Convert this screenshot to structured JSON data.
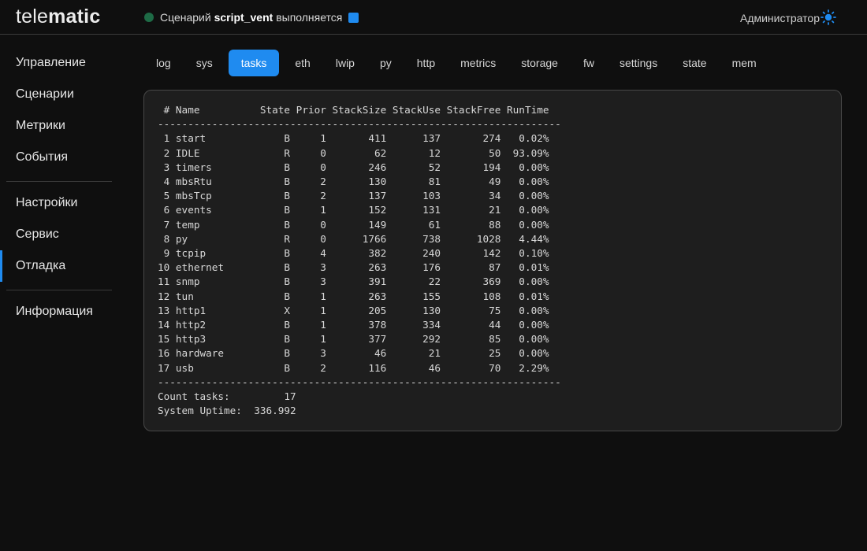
{
  "header": {
    "logo_light": "tele",
    "logo_bold": "matic",
    "status_prefix": "Сценарий",
    "status_script": "script_vent",
    "status_suffix": "выполняется",
    "user": "Администратор",
    "theme_icon": "sun-icon",
    "colors": {
      "accent": "#1f8bf0",
      "running_dot": "#1e6b46"
    }
  },
  "sidebar": {
    "items": [
      {
        "label": "Управление"
      },
      {
        "label": "Сценарии"
      },
      {
        "label": "Метрики"
      },
      {
        "label": "События"
      },
      {
        "label": "Настройки"
      },
      {
        "label": "Сервис"
      },
      {
        "label": "Отладка",
        "active": true
      },
      {
        "label": "Информация"
      }
    ]
  },
  "tabs": [
    {
      "label": "log"
    },
    {
      "label": "sys"
    },
    {
      "label": "tasks",
      "active": true
    },
    {
      "label": "eth"
    },
    {
      "label": "lwip"
    },
    {
      "label": "py"
    },
    {
      "label": "http"
    },
    {
      "label": "metrics"
    },
    {
      "label": "storage"
    },
    {
      "label": "fw"
    },
    {
      "label": "settings"
    },
    {
      "label": "state"
    },
    {
      "label": "mem"
    }
  ],
  "console": {
    "header": " # Name          State Prior StackSize StackUse StackFree RunTime",
    "separator": "-------------------------------------------------------------------",
    "rows": [
      " 1 start             B     1       411      137       274   0.02%",
      " 2 IDLE              R     0        62       12        50  93.09%",
      " 3 timers            B     0       246       52       194   0.00%",
      " 4 mbsRtu            B     2       130       81        49   0.00%",
      " 5 mbsTcp            B     2       137      103        34   0.00%",
      " 6 events            B     1       152      131        21   0.00%",
      " 7 temp              B     0       149       61        88   0.00%",
      " 8 py                R     0      1766      738      1028   4.44%",
      " 9 tcpip             B     4       382      240       142   0.10%",
      "10 ethernet          B     3       263      176        87   0.01%",
      "11 snmp              B     3       391       22       369   0.00%",
      "12 tun               B     1       263      155       108   0.01%",
      "13 http1             X     1       205      130        75   0.00%",
      "14 http2             B     1       378      334        44   0.00%",
      "15 http3             B     1       377      292        85   0.00%",
      "16 hardware          B     3        46       21        25   0.00%",
      "17 usb               B     2       116       46        70   2.29%"
    ],
    "footer": [
      "Count tasks:         17",
      "System Uptime:  336.992"
    ]
  }
}
